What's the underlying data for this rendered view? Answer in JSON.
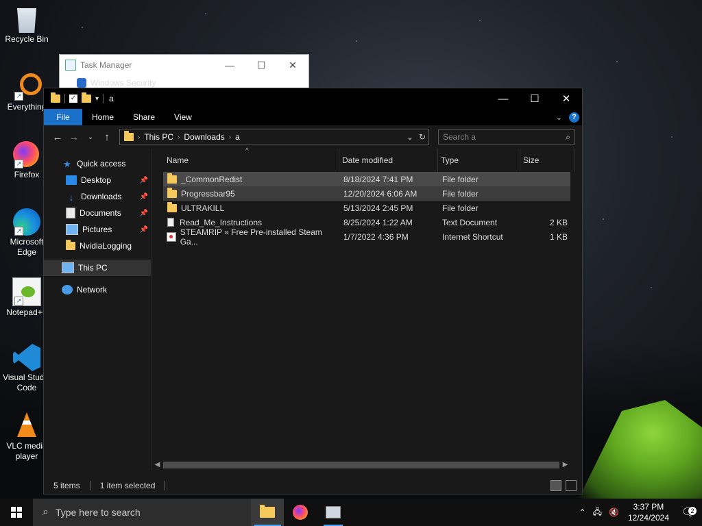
{
  "desktop": {
    "icons": [
      {
        "label": "Recycle Bin",
        "icon": "recycle-bin-icon"
      },
      {
        "label": "Everything",
        "icon": "everything-icon"
      },
      {
        "label": "Firefox",
        "icon": "firefox-icon"
      },
      {
        "label": "Microsoft Edge",
        "icon": "edge-icon"
      },
      {
        "label": "Notepad++",
        "icon": "notepadpp-icon"
      },
      {
        "label": "Visual Studio Code",
        "icon": "vscode-icon"
      },
      {
        "label": "VLC media player",
        "icon": "vlc-icon"
      }
    ]
  },
  "task_manager": {
    "title": "Task Manager",
    "item": "Windows Security"
  },
  "explorer": {
    "title": "a",
    "ribbon": {
      "file": "File",
      "home": "Home",
      "share": "Share",
      "view": "View"
    },
    "address": {
      "crumbs": [
        "This PC",
        "Downloads",
        "a"
      ]
    },
    "search": {
      "placeholder": "Search a"
    },
    "nav": {
      "quick_access": "Quick access",
      "desktop": "Desktop",
      "downloads": "Downloads",
      "documents": "Documents",
      "pictures": "Pictures",
      "nvidialogging": "NvidiaLogging",
      "this_pc": "This PC",
      "network": "Network"
    },
    "columns": {
      "name": "Name",
      "date": "Date modified",
      "type": "Type",
      "size": "Size"
    },
    "files": [
      {
        "name": "_CommonRedist",
        "date": "8/18/2024 7:41 PM",
        "type": "File folder",
        "size": ""
      },
      {
        "name": "Progressbar95",
        "date": "12/20/2024 6:06 AM",
        "type": "File folder",
        "size": ""
      },
      {
        "name": "ULTRAKILL",
        "date": "5/13/2024 2:45 PM",
        "type": "File folder",
        "size": ""
      },
      {
        "name": "Read_Me_Instructions",
        "date": "8/25/2024 1:22 AM",
        "type": "Text Document",
        "size": "2 KB"
      },
      {
        "name": "STEAMRIP » Free Pre-installed Steam Ga...",
        "date": "1/7/2022 4:36 PM",
        "type": "Internet Shortcut",
        "size": "1 KB"
      }
    ],
    "status": {
      "count": "5 items",
      "selected": "1 item selected"
    }
  },
  "taskbar": {
    "search_placeholder": "Type here to search",
    "time": "3:37 PM",
    "date": "12/24/2024",
    "notifications": "2"
  }
}
